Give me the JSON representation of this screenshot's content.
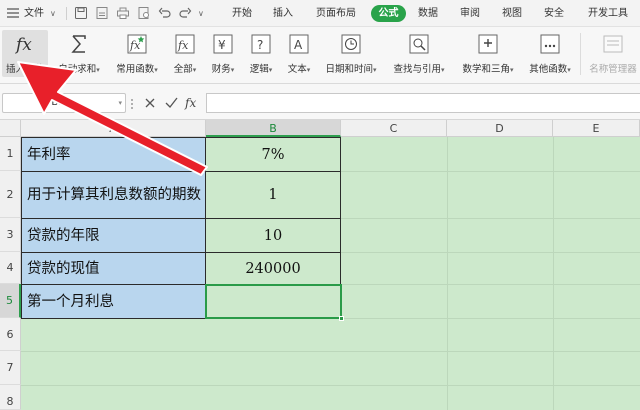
{
  "menubar": {
    "file_label": "文件",
    "tabs": [
      {
        "label": "开始"
      },
      {
        "label": "插入"
      },
      {
        "label": "页面布局"
      },
      {
        "label": "公式"
      },
      {
        "label": "数据"
      },
      {
        "label": "审阅"
      },
      {
        "label": "视图"
      },
      {
        "label": "安全"
      },
      {
        "label": "开发工具"
      }
    ],
    "active_tab": "公式",
    "active_color": "#29a34a"
  },
  "ribbon": {
    "buttons": [
      {
        "label": "插入函数",
        "icon": "fx-icon"
      },
      {
        "label": "自动求和",
        "icon": "sigma-icon"
      },
      {
        "label": "常用函数",
        "icon": "star-fx-icon"
      },
      {
        "label": "全部",
        "icon": "all-fx-icon"
      },
      {
        "label": "财务",
        "icon": "yen-icon"
      },
      {
        "label": "逻辑",
        "icon": "question-icon"
      },
      {
        "label": "文本",
        "icon": "text-a-icon"
      },
      {
        "label": "日期和时间",
        "icon": "clock-icon"
      },
      {
        "label": "查找与引用",
        "icon": "search-book-icon"
      },
      {
        "label": "数学和三角",
        "icon": "math-icon"
      },
      {
        "label": "其他函数",
        "icon": "more-functions-icon"
      },
      {
        "label": "名称管理器",
        "icon": "name-manager-icon"
      }
    ]
  },
  "formula_bar": {
    "name_box": "B5",
    "fx_symbol": "fx",
    "formula": ""
  },
  "sheet": {
    "columns": [
      "A",
      "B",
      "C",
      "D",
      "E"
    ],
    "rows": [
      "1",
      "2",
      "3",
      "4",
      "5",
      "6",
      "7",
      "8"
    ],
    "active_cell": "B5",
    "cells": [
      {
        "a": "年利率",
        "b": "7%"
      },
      {
        "a": "用于计算其利息数额的期数",
        "b": "1"
      },
      {
        "a": "贷款的年限",
        "b": "10"
      },
      {
        "a": "贷款的现值",
        "b": "240000"
      },
      {
        "a": "第一个月利息",
        "b": ""
      }
    ],
    "colors": {
      "sheet_fill": "#cde9cc",
      "label_fill": "#b9d6ee",
      "selection": "#2a9b48",
      "arrow": "#e8202a"
    }
  }
}
